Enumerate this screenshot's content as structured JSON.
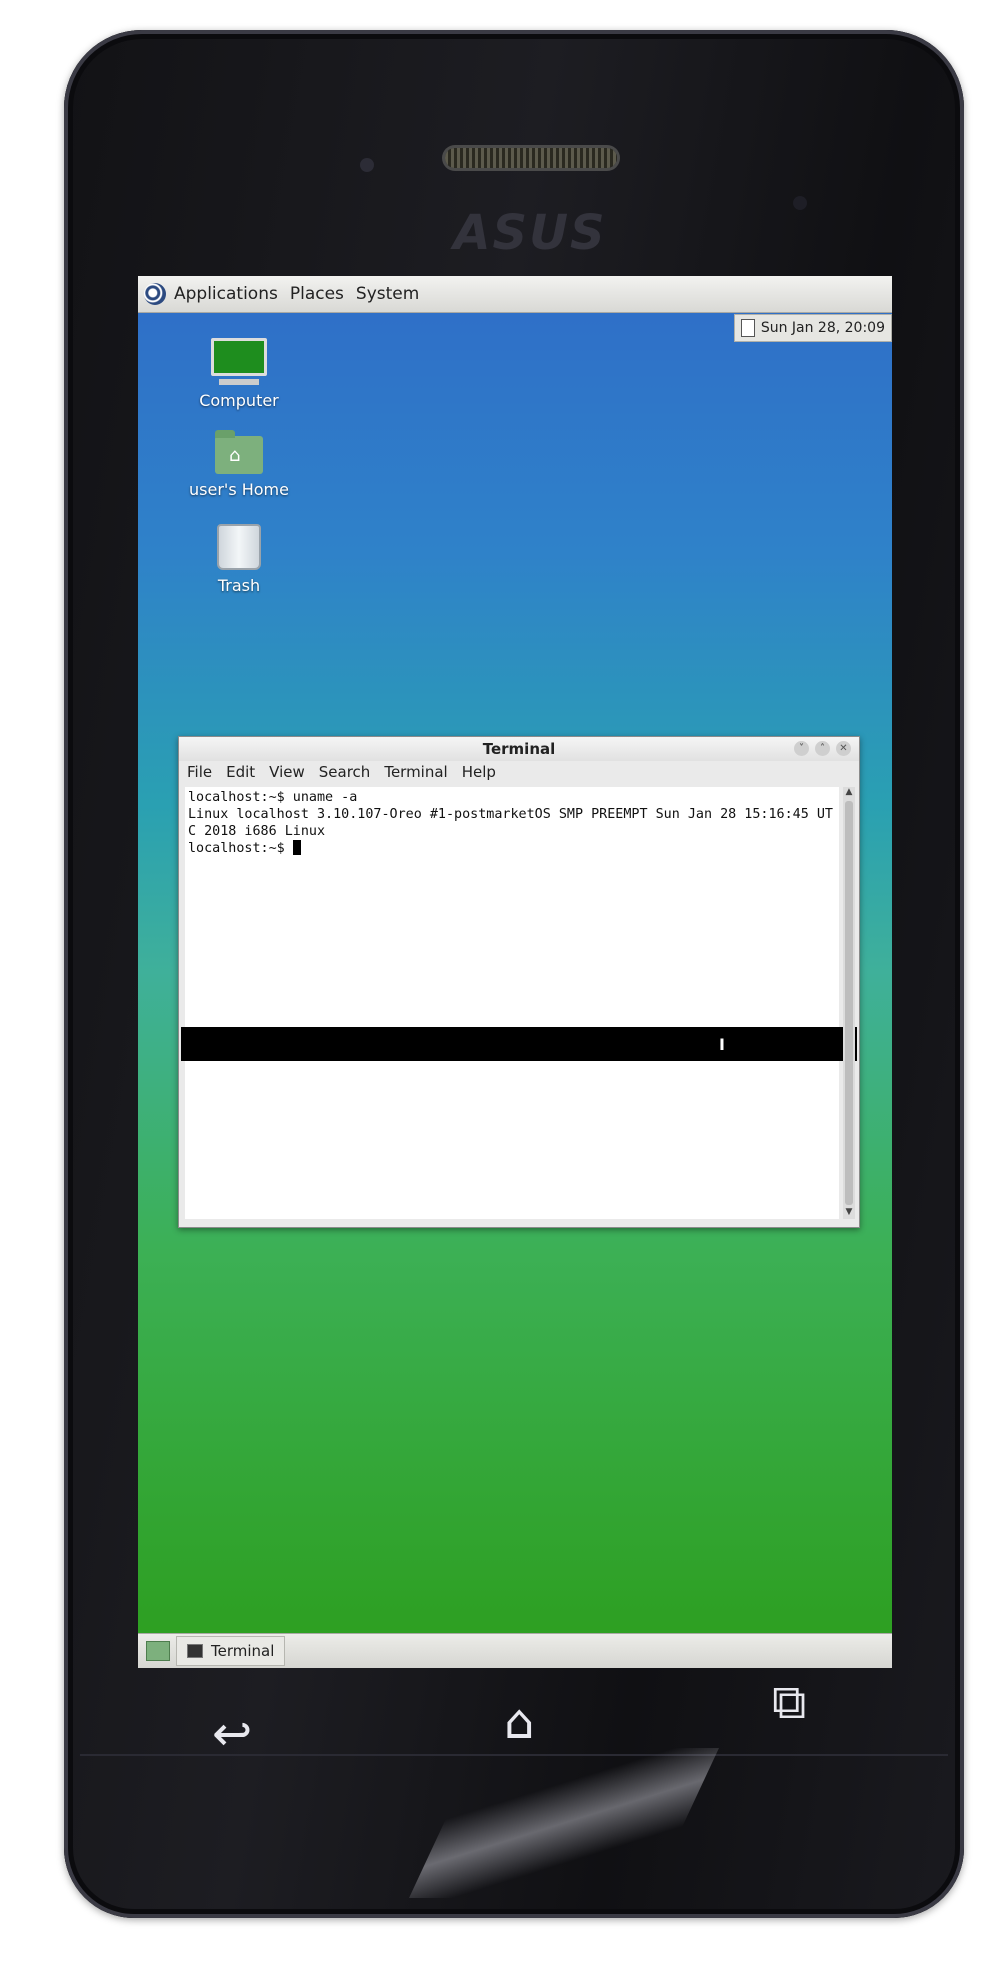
{
  "device": {
    "brand": "ASUS"
  },
  "top_panel": {
    "menus": [
      "Applications",
      "Places",
      "System"
    ],
    "clock": "Sun Jan 28, 20:09"
  },
  "desktop_icons": [
    {
      "label": "Computer",
      "icon": "computer-icon"
    },
    {
      "label": "user's Home",
      "icon": "home-folder-icon"
    },
    {
      "label": "Trash",
      "icon": "trash-icon"
    }
  ],
  "terminal": {
    "title": "Terminal",
    "menus": [
      "File",
      "Edit",
      "View",
      "Search",
      "Terminal",
      "Help"
    ],
    "lines": [
      "localhost:~$ uname -a",
      "Linux localhost 3.10.107-Oreo #1-postmarketOS SMP PREEMPT Sun Jan 28 15:16:45 UTC 2018 i686 Linux",
      "localhost:~$ "
    ]
  },
  "bottom_panel": {
    "task_label": "Terminal"
  },
  "nav_keys": {
    "back": "back-icon",
    "home": "home-icon",
    "recent": "recent-apps-icon"
  }
}
